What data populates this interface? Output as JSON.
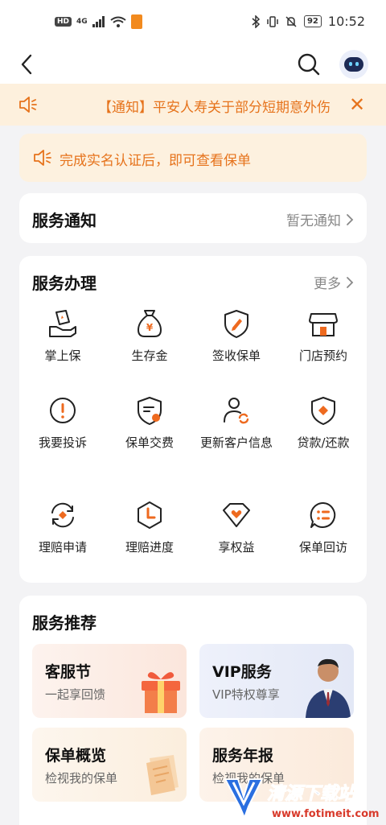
{
  "status_bar": {
    "hd": "HD",
    "signal": "4G",
    "battery": "92",
    "time": "10:52"
  },
  "notice": {
    "text": "【通知】平安人寿关于部分短期意外伤"
  },
  "tip": {
    "text": "完成实名认证后，即可查看保单"
  },
  "service_notice": {
    "title": "服务通知",
    "status": "暂无通知"
  },
  "service_handling": {
    "title": "服务办理",
    "more": "更多",
    "items": [
      {
        "label": "掌上保",
        "icon": "hand-shield-icon"
      },
      {
        "label": "生存金",
        "icon": "money-bag-icon"
      },
      {
        "label": "签收保单",
        "icon": "shield-pen-icon"
      },
      {
        "label": "门店预约",
        "icon": "store-icon"
      },
      {
        "label": "我要投诉",
        "icon": "exclamation-circle-icon"
      },
      {
        "label": "保单交费",
        "icon": "policy-pay-icon"
      },
      {
        "label": "更新客户信息",
        "icon": "user-refresh-icon"
      },
      {
        "label": "贷款/还款",
        "icon": "shield-diamond-icon"
      },
      {
        "label": "理赔申请",
        "icon": "claim-refresh-icon"
      },
      {
        "label": "理赔进度",
        "icon": "hexagon-clock-icon"
      },
      {
        "label": "享权益",
        "icon": "diamond-heart-icon"
      },
      {
        "label": "保单回访",
        "icon": "chat-list-icon"
      }
    ]
  },
  "recommend": {
    "title": "服务推荐",
    "tiles": [
      {
        "title": "客服节",
        "sub": "一起享回馈"
      },
      {
        "title": "VIP服务",
        "sub": "VIP特权尊享"
      },
      {
        "title": "保单概览",
        "sub": "检视我的保单"
      },
      {
        "title": "服务年报",
        "sub": "检视我的保单"
      }
    ]
  },
  "watermark": {
    "name": "清源下载站",
    "url": "www.fotimeit.com"
  },
  "colors": {
    "accent": "#e6731c",
    "icon_stroke": "#222222",
    "icon_accent": "#ee6a1f",
    "banner_bg": "#fdf0dd"
  }
}
